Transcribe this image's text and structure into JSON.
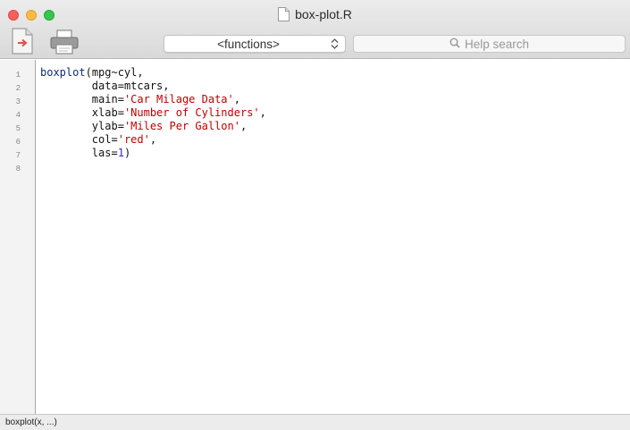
{
  "window": {
    "title": "box-plot.R",
    "file_icon": "document-icon"
  },
  "toolbar": {
    "source_icon": "source-file-icon",
    "print_icon": "printer-icon",
    "functions_selected": "<functions>",
    "help_search_placeholder": "Help search",
    "help_search_icon": "magnifier-icon"
  },
  "editor": {
    "line_numbers": [
      "1",
      "2",
      "3",
      "4",
      "5",
      "6",
      "7",
      "8"
    ],
    "lines": [
      [
        {
          "t": "fn",
          "v": "boxplot"
        },
        {
          "t": "op",
          "v": "("
        },
        {
          "t": "id",
          "v": "mpg~cyl,"
        }
      ],
      [
        {
          "t": "id",
          "v": "        data"
        },
        {
          "t": "op",
          "v": "="
        },
        {
          "t": "id",
          "v": "mtcars,"
        }
      ],
      [
        {
          "t": "id",
          "v": "        main"
        },
        {
          "t": "op",
          "v": "="
        },
        {
          "t": "str",
          "v": "'Car Milage Data'"
        },
        {
          "t": "op",
          "v": ","
        }
      ],
      [
        {
          "t": "id",
          "v": "        xlab"
        },
        {
          "t": "op",
          "v": "="
        },
        {
          "t": "str",
          "v": "'Number of Cylinders'"
        },
        {
          "t": "op",
          "v": ","
        }
      ],
      [
        {
          "t": "id",
          "v": "        ylab"
        },
        {
          "t": "op",
          "v": "="
        },
        {
          "t": "str",
          "v": "'Miles Per Gallon'"
        },
        {
          "t": "op",
          "v": ","
        }
      ],
      [
        {
          "t": "id",
          "v": "        col"
        },
        {
          "t": "op",
          "v": "="
        },
        {
          "t": "str",
          "v": "'red'"
        },
        {
          "t": "op",
          "v": ","
        }
      ],
      [
        {
          "t": "id",
          "v": "        las"
        },
        {
          "t": "op",
          "v": "="
        },
        {
          "t": "num",
          "v": "1"
        },
        {
          "t": "op",
          "v": ")"
        }
      ],
      []
    ]
  },
  "status": {
    "text": "boxplot(x, ...)"
  },
  "colors": {
    "function": "#0c2c84",
    "string": "#c00000",
    "number": "#2a2acd"
  }
}
